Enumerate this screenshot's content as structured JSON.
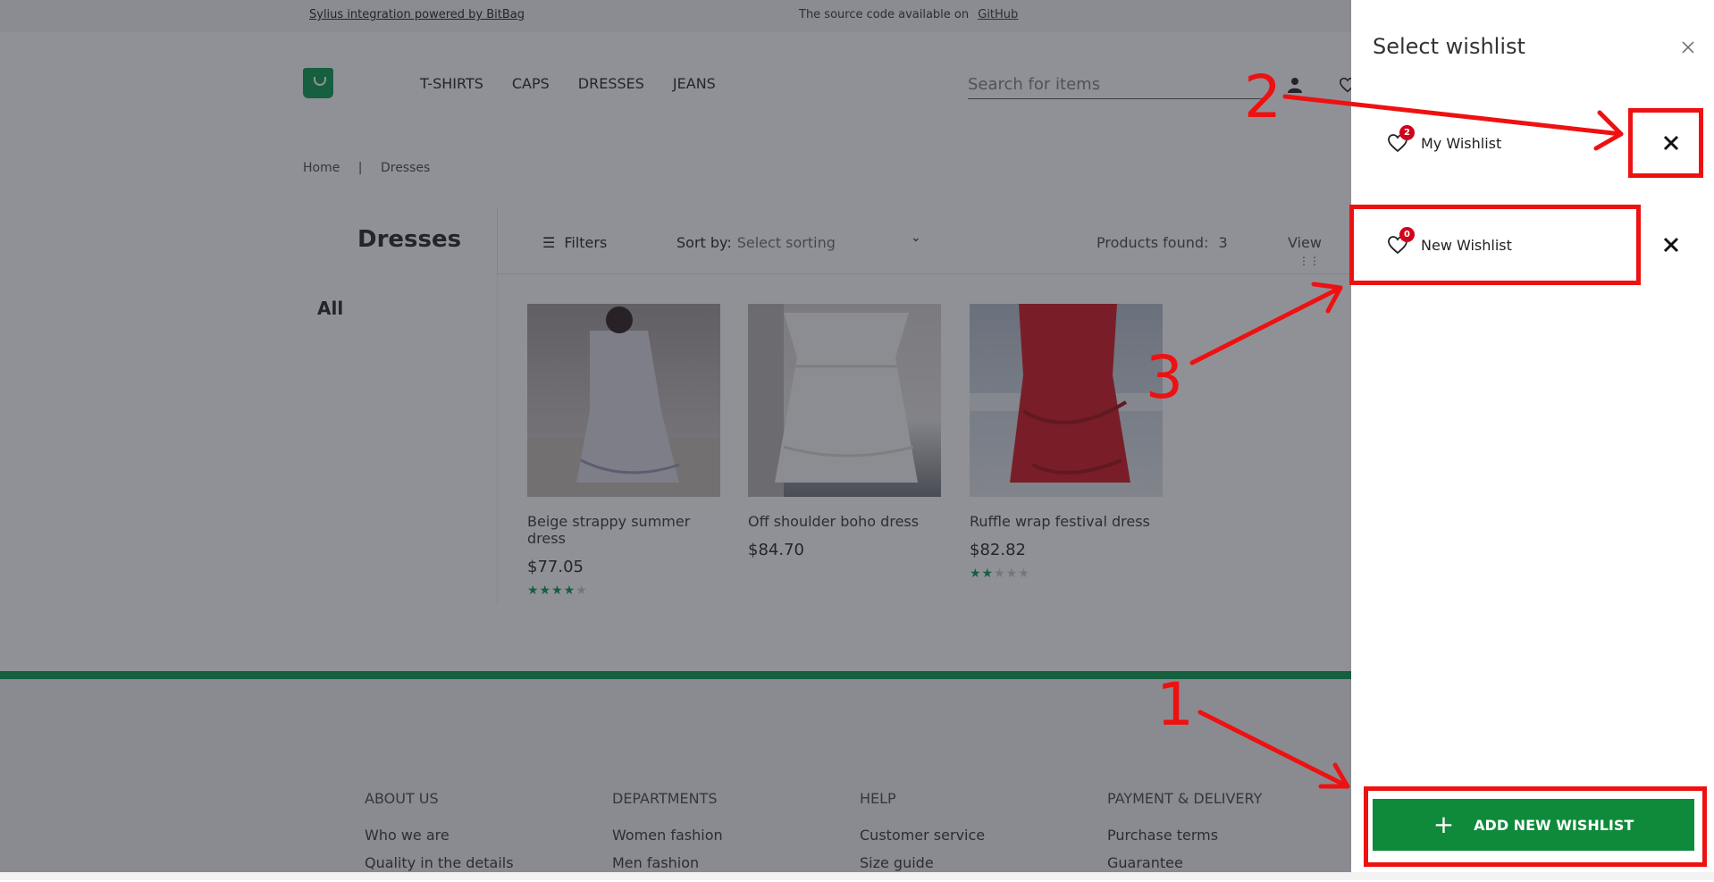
{
  "topbar": {
    "integration_link": "Sylius integration powered by BitBag",
    "source_text": "The source code available on",
    "source_link": "GitHub"
  },
  "nav": {
    "items": [
      "T-SHIRTS",
      "CAPS",
      "DRESSES",
      "JEANS"
    ]
  },
  "search": {
    "placeholder": "Search for items"
  },
  "breadcrumb": {
    "home": "Home",
    "separator": "|",
    "current": "Dresses"
  },
  "category": {
    "title": "Dresses",
    "filters_label": "Filters",
    "sort_label": "Sort by:",
    "sort_value": "Select sorting",
    "products_found_label": "Products found:",
    "products_found_count": "3",
    "view_label": "View",
    "sidebar_all": "All"
  },
  "products": [
    {
      "name": "Beige strappy summer dress",
      "price": "$77.05",
      "rating": 4
    },
    {
      "name": "Off shoulder boho dress",
      "price": "$84.70",
      "rating": 0
    },
    {
      "name": "Ruffle wrap festival dress",
      "price": "$82.82",
      "rating": 2
    }
  ],
  "footer": {
    "columns": [
      {
        "heading": "ABOUT US",
        "links": [
          "Who we are",
          "Quality in the details"
        ]
      },
      {
        "heading": "DEPARTMENTS",
        "links": [
          "Women fashion",
          "Men fashion"
        ]
      },
      {
        "heading": "HELP",
        "links": [
          "Customer service",
          "Size guide"
        ]
      },
      {
        "heading": "PAYMENT & DELIVERY",
        "links": [
          "Purchase terms",
          "Guarantee"
        ]
      }
    ]
  },
  "drawer": {
    "title": "Select wishlist",
    "wishlists": [
      {
        "name": "My Wishlist",
        "count": "2"
      },
      {
        "name": "New Wishlist",
        "count": "0"
      }
    ],
    "add_button_label": "ADD NEW WISHLIST"
  },
  "annotations": {
    "labels": [
      "1",
      "2",
      "3"
    ]
  },
  "colors": {
    "accent_green": "#1aa05a",
    "button_green": "#0e8a3a",
    "badge_red": "#d0021b",
    "annotation_red": "#ee1111"
  }
}
